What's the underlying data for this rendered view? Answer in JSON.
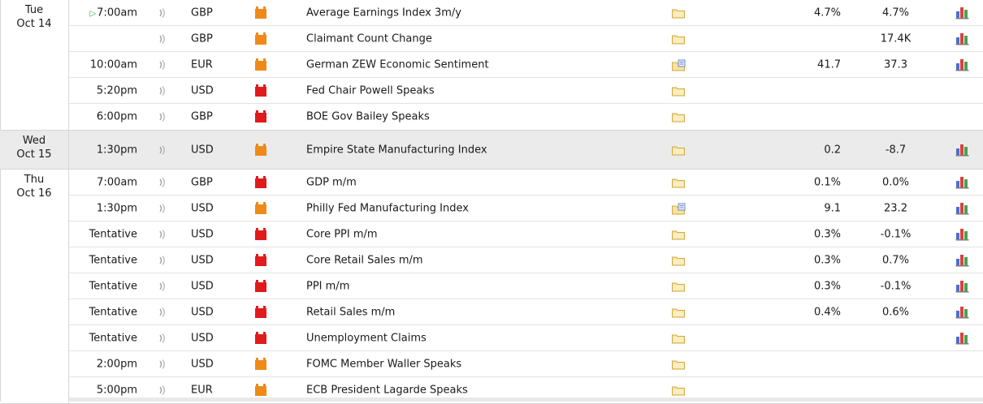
{
  "colors": {
    "high_impact": "#e01b1b",
    "medium_impact": "#ef8a18",
    "live_marker": "#2bb34a",
    "row_border": "#e3e3e3",
    "shaded_day_bg": "#ebebeb"
  },
  "icons": {
    "sound": "speaker-wave-icon",
    "impact_high": "red-impact-folder-icon",
    "impact_medium": "orange-impact-folder-icon",
    "detail": "yellow-folder-icon",
    "detail_with_doc": "folder-document-icon",
    "graph": "bar-graph-icon"
  },
  "days": [
    {
      "weekday": "Tue",
      "date": "Oct 14",
      "events": [
        {
          "time": "7:00am",
          "live": true,
          "currency": "GBP",
          "impact": "medium",
          "title": "Average Earnings Index 3m/y",
          "detail_doc": false,
          "actual": "4.7%",
          "forecast": "4.7%",
          "graph": true
        },
        {
          "time": "",
          "live": false,
          "currency": "GBP",
          "impact": "medium",
          "title": "Claimant Count Change",
          "detail_doc": false,
          "actual": "",
          "forecast": "17.4K",
          "graph": true
        },
        {
          "time": "10:00am",
          "live": false,
          "currency": "EUR",
          "impact": "medium",
          "title": "German ZEW Economic Sentiment",
          "detail_doc": true,
          "actual": "41.7",
          "forecast": "37.3",
          "graph": true
        },
        {
          "time": "5:20pm",
          "live": false,
          "currency": "USD",
          "impact": "high",
          "title": "Fed Chair Powell Speaks",
          "detail_doc": false,
          "actual": "",
          "forecast": "",
          "graph": false
        },
        {
          "time": "6:00pm",
          "live": false,
          "currency": "GBP",
          "impact": "high",
          "title": "BOE Gov Bailey Speaks",
          "detail_doc": false,
          "actual": "",
          "forecast": "",
          "graph": false
        }
      ]
    },
    {
      "weekday": "Wed",
      "date": "Oct 15",
      "shaded": true,
      "events": [
        {
          "time": "1:30pm",
          "live": false,
          "currency": "USD",
          "impact": "medium",
          "title": "Empire State Manufacturing Index",
          "detail_doc": false,
          "actual": "0.2",
          "forecast": "-8.7",
          "graph": true
        }
      ]
    },
    {
      "weekday": "Thu",
      "date": "Oct 16",
      "events": [
        {
          "time": "7:00am",
          "live": false,
          "currency": "GBP",
          "impact": "high",
          "title": "GDP m/m",
          "detail_doc": false,
          "actual": "0.1%",
          "forecast": "0.0%",
          "graph": true
        },
        {
          "time": "1:30pm",
          "live": false,
          "currency": "USD",
          "impact": "medium",
          "title": "Philly Fed Manufacturing Index",
          "detail_doc": true,
          "actual": "9.1",
          "forecast": "23.2",
          "graph": true
        },
        {
          "time": "Tentative",
          "live": false,
          "currency": "USD",
          "impact": "high",
          "title": "Core PPI m/m",
          "detail_doc": false,
          "actual": "0.3%",
          "forecast": "-0.1%",
          "graph": true
        },
        {
          "time": "Tentative",
          "live": false,
          "currency": "USD",
          "impact": "high",
          "title": "Core Retail Sales m/m",
          "detail_doc": false,
          "actual": "0.3%",
          "forecast": "0.7%",
          "graph": true
        },
        {
          "time": "Tentative",
          "live": false,
          "currency": "USD",
          "impact": "high",
          "title": "PPI m/m",
          "detail_doc": false,
          "actual": "0.3%",
          "forecast": "-0.1%",
          "graph": true
        },
        {
          "time": "Tentative",
          "live": false,
          "currency": "USD",
          "impact": "high",
          "title": "Retail Sales m/m",
          "detail_doc": false,
          "actual": "0.4%",
          "forecast": "0.6%",
          "graph": true
        },
        {
          "time": "Tentative",
          "live": false,
          "currency": "USD",
          "impact": "high",
          "title": "Unemployment Claims",
          "detail_doc": false,
          "actual": "",
          "forecast": "",
          "graph": true
        },
        {
          "time": "2:00pm",
          "live": false,
          "currency": "USD",
          "impact": "medium",
          "title": "FOMC Member Waller Speaks",
          "detail_doc": false,
          "actual": "",
          "forecast": "",
          "graph": false
        },
        {
          "time": "5:00pm",
          "live": false,
          "currency": "EUR",
          "impact": "medium",
          "title": "ECB President Lagarde Speaks",
          "detail_doc": false,
          "actual": "",
          "forecast": "",
          "graph": false
        }
      ]
    }
  ]
}
